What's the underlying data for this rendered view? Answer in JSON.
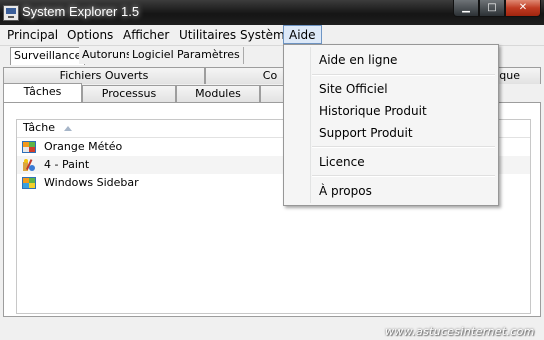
{
  "window": {
    "title": "System Explorer 1.5",
    "controls": {
      "minimize": "▁",
      "maximize": "□",
      "close": "✕"
    }
  },
  "menubar": [
    "Principal",
    "Options",
    "Afficher",
    "Utilitaires Système",
    "Aide"
  ],
  "subtabs": [
    "Surveillance",
    "Autoruns",
    "Logiciel",
    "Paramètres"
  ],
  "tabs_row1": [
    "Fichiers Ouverts",
    "Co"
  ],
  "tabs_row1_right": "ique",
  "tabs_row2": [
    "Tâches",
    "Processus",
    "Modules"
  ],
  "list": {
    "column_header": "Tâche",
    "rows": [
      {
        "label": "Orange Météo",
        "icon": "orange-meteo-icon"
      },
      {
        "label": "4 - Paint",
        "icon": "paint-icon"
      },
      {
        "label": "Windows Sidebar",
        "icon": "windows-sidebar-icon"
      }
    ]
  },
  "aide_menu": {
    "items": [
      "Aide en ligne",
      "Site Officiel",
      "Historique Produit",
      "Support Produit",
      "Licence",
      "À propos"
    ]
  },
  "watermark": "www.astucesinternet.com",
  "colors": {
    "titlebar": "#1e1e1e",
    "close_button": "#c03b22",
    "menu_highlight": "#dde9f8"
  }
}
